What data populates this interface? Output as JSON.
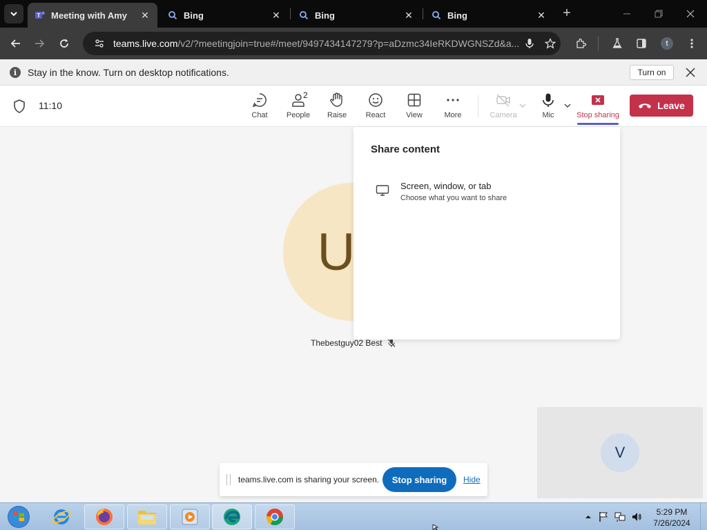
{
  "browser": {
    "tabs": [
      {
        "title": "Meeting with Amy",
        "favicon": "teams-icon",
        "active": true
      },
      {
        "title": "Bing",
        "favicon": "search-icon",
        "active": false
      },
      {
        "title": "Bing",
        "favicon": "search-icon",
        "active": false
      },
      {
        "title": "Bing",
        "favicon": "search-icon",
        "active": false
      }
    ],
    "url_host": "teams.live.com",
    "url_rest": "/v2/?meetingjoin=true#/meet/9497434147279?p=aDzmc34IeRKDWGNSZd&a...",
    "profile_initial": "t"
  },
  "notification": {
    "text": "Stay in the know. Turn on desktop notifications.",
    "turn_on_label": "Turn on"
  },
  "meeting": {
    "time": "11:10",
    "controls": {
      "chat": "Chat",
      "people": "People",
      "people_count": "2",
      "raise": "Raise",
      "react": "React",
      "view": "View",
      "more": "More",
      "camera": "Camera",
      "mic": "Mic",
      "stop_sharing": "Stop sharing",
      "leave": "Leave"
    },
    "participant": {
      "initial": "U",
      "name": "Thebestguy02 Best"
    },
    "self_initial": "V",
    "share_panel": {
      "title": "Share content",
      "option_title": "Screen, window, or tab",
      "option_subtitle": "Choose what you want to share"
    },
    "share_toast": {
      "text": "teams.live.com is sharing your screen.",
      "stop_label": "Stop sharing",
      "hide_label": "Hide"
    }
  },
  "taskbar": {
    "time": "5:29 PM",
    "date": "7/26/2024"
  },
  "colors": {
    "leave_red": "#c4314b",
    "teams_purple": "#5b5fc7",
    "stop_blue": "#0f6cbd"
  }
}
